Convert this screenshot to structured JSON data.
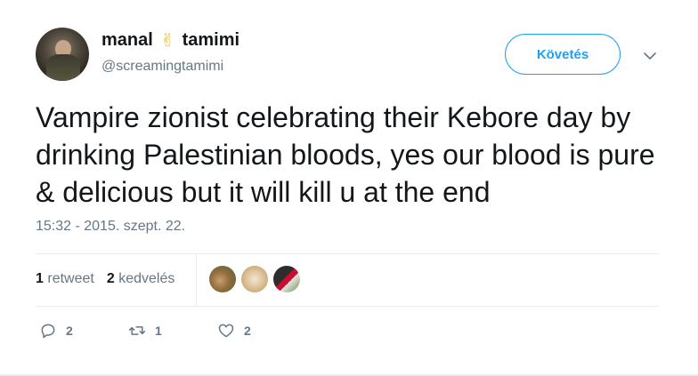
{
  "user": {
    "name_first": "manal",
    "emoji": "✌",
    "name_last": "tamimi",
    "handle": "@screamingtamimi"
  },
  "follow_label": "Követés",
  "tweet_text": "Vampire zionist celebrating their Kebore day by drinking Palestinian bloods, yes our blood is pure & delicious but it will kill u at the end",
  "timestamp": "15:32 - 2015. szept. 22.",
  "stats": {
    "retweet_count": "1",
    "retweet_label": "retweet",
    "like_count": "2",
    "like_label": "kedvelés"
  },
  "actions": {
    "reply_count": "2",
    "retweet_count": "1",
    "like_count": "2"
  },
  "colors": {
    "accent": "#1da1f2",
    "muted": "#657786",
    "text": "#14171a",
    "divider": "#e6ecf0"
  },
  "icons": [
    "reply-icon",
    "retweet-icon",
    "heart-icon",
    "chevron-down-icon"
  ]
}
